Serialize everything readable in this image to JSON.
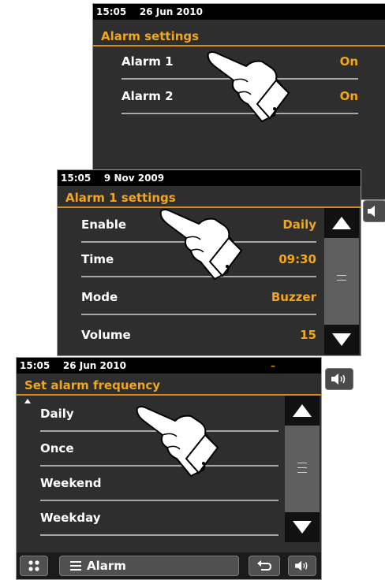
{
  "screen1": {
    "time": "15:05",
    "date": "26 Jun 2010",
    "title": "Alarm settings",
    "rows": [
      {
        "label": "Alarm 1",
        "value": "On"
      },
      {
        "label": "Alarm 2",
        "value": "On"
      }
    ]
  },
  "screen2": {
    "time": "15:05",
    "date": "9 Nov 2009",
    "title": "Alarm 1 settings",
    "rows": [
      {
        "label": "Enable",
        "value": "Daily"
      },
      {
        "label": "Time",
        "value": "09:30"
      },
      {
        "label": "Mode",
        "value": "Buzzer"
      },
      {
        "label": "Volume",
        "value": "15"
      }
    ]
  },
  "screen3": {
    "time": "15:05",
    "date": "26 Jun 2010",
    "title": "Set alarm frequency",
    "rows": [
      {
        "label": "Daily"
      },
      {
        "label": "Once"
      },
      {
        "label": "Weekend"
      },
      {
        "label": "Weekday"
      }
    ],
    "bottom": {
      "menu_label": "Alarm"
    }
  },
  "icons": {
    "scroll_up": "triangle-up-icon",
    "scroll_down": "triangle-down-icon",
    "volume": "speaker-icon",
    "home": "grid-icon",
    "menu": "menu-lines-icon",
    "back": "back-arrow-icon",
    "pointer": "pointing-hand-icon"
  },
  "colors": {
    "accent": "#f2a71b",
    "screen_bg": "#2e2e2e",
    "status_bg": "#000000"
  }
}
